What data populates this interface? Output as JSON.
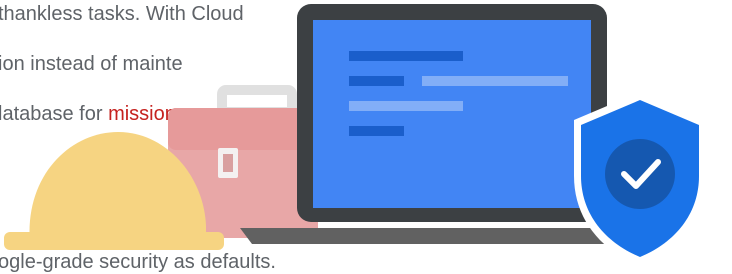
{
  "body_text": {
    "line1": "thankless tasks. With Cloud",
    "line2": "ion instead of mainte",
    "line3_prefix": "latabase for",
    "line3_highlight": " mission-c",
    "line4": "ogle-grade security as defaults."
  },
  "illustration": {
    "icons": [
      "hard-hat-icon",
      "toolbox-icon",
      "laptop-icon",
      "shield-check-icon"
    ],
    "colors": {
      "hard_hat": "#f6d482",
      "toolbox": "#e6a0a0",
      "laptop_frame": "#3c4043",
      "laptop_screen": "#4285f4",
      "shield": "#1a73e8",
      "shield_inner": "#1558b0",
      "text": "#5f6368",
      "highlight_text": "#c5221f"
    }
  }
}
